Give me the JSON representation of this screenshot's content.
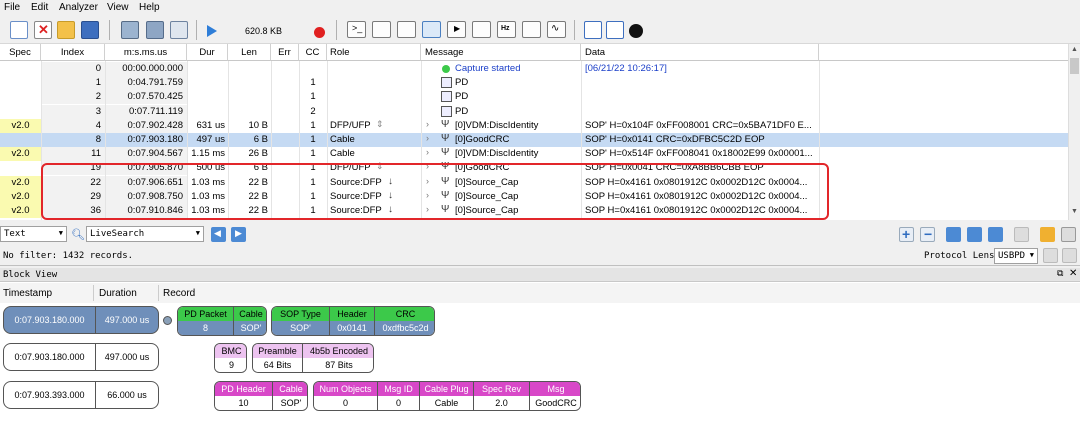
{
  "menu": [
    "File",
    "Edit",
    "Analyzer",
    "View",
    "Help"
  ],
  "toolbar": {
    "size_label": "620.8 KB"
  },
  "columns": [
    "Spec",
    "Index",
    "m:s.ms.us",
    "Dur",
    "Len",
    "Err",
    "CC",
    "Role",
    "Message",
    "Data"
  ],
  "rows": [
    {
      "spec": "",
      "index": "0",
      "time": "00:00.000.000",
      "dur": "",
      "len": "",
      "err": "",
      "cc": "",
      "role": "",
      "message": "Capture started",
      "data": "[06/21/22 10:26:17]"
    },
    {
      "spec": "",
      "index": "1",
      "time": "0:04.791.759",
      "dur": "",
      "len": "",
      "err": "",
      "cc": "1",
      "role": "",
      "message": "PD",
      "data": ""
    },
    {
      "spec": "",
      "index": "2",
      "time": "0:07.570.425",
      "dur": "",
      "len": "",
      "err": "",
      "cc": "1",
      "role": "",
      "message": "PD",
      "data": ""
    },
    {
      "spec": "",
      "index": "3",
      "time": "0:07.711.119",
      "dur": "",
      "len": "",
      "err": "",
      "cc": "2",
      "role": "",
      "message": "PD",
      "data": ""
    },
    {
      "spec": "v2.0",
      "index": "4",
      "time": "0:07.902.428",
      "dur": "631 us",
      "len": "10 B",
      "err": "",
      "cc": "1",
      "role": "DFP/UFP",
      "message": "[0]VDM:DiscIdentity",
      "data": "SOP' H=0x104F 0xFF008001 CRC=0x5BA71DF0 E..."
    },
    {
      "spec": "",
      "index": "8",
      "time": "0:07.903.180",
      "dur": "497 us",
      "len": "6 B",
      "err": "",
      "cc": "1",
      "role": "Cable",
      "message": "[0]GoodCRC",
      "data": "SOP' H=0x0141 CRC=0xDFBC5C2D EOP"
    },
    {
      "spec": "v2.0",
      "index": "11",
      "time": "0:07.904.567",
      "dur": "1.15 ms",
      "len": "26 B",
      "err": "",
      "cc": "1",
      "role": "Cable",
      "message": "[0]VDM:DiscIdentity",
      "data": "SOP' H=0x514F 0xFF008041 0x18002E99 0x00001..."
    },
    {
      "spec": "",
      "index": "19",
      "time": "0:07.905.870",
      "dur": "500 us",
      "len": "6 B",
      "err": "",
      "cc": "1",
      "role": "DFP/UFP",
      "message": "[0]GoodCRC",
      "data": "SOP' H=0x0041 CRC=0xA8BB6CBB EOP"
    },
    {
      "spec": "v2.0",
      "index": "22",
      "time": "0:07.906.651",
      "dur": "1.03 ms",
      "len": "22 B",
      "err": "",
      "cc": "1",
      "role": "Source:DFP",
      "message": "[0]Source_Cap",
      "data": "SOP H=0x4161 0x0801912C 0x0002D12C 0x0004..."
    },
    {
      "spec": "v2.0",
      "index": "29",
      "time": "0:07.908.750",
      "len": "22 B",
      "dur": "1.03 ms",
      "err": "",
      "cc": "1",
      "role": "Source:DFP",
      "message": "[0]Source_Cap",
      "data": "SOP H=0x4161 0x0801912C 0x0002D12C 0x0004..."
    },
    {
      "spec": "v2.0",
      "index": "36",
      "time": "0:07.910.846",
      "dur": "1.03 ms",
      "len": "22 B",
      "err": "",
      "cc": "1",
      "role": "Source:DFP",
      "message": "[0]Source_Cap",
      "data": "SOP H=0x4161 0x0801912C 0x0002D12C 0x0004..."
    }
  ],
  "filter": {
    "type": "Text",
    "search": "LiveSearch"
  },
  "status": {
    "text": "No filter: 1432 records.",
    "lens_label": "Protocol Lens:",
    "lens_value": "USBPD"
  },
  "blockview": {
    "title": "Block View",
    "headers": [
      "Timestamp",
      "Duration",
      "Record"
    ],
    "rows": [
      {
        "timestamp": "0:07.903.180.000",
        "duration": "497.000 us"
      },
      {
        "timestamp": "0:07.903.180.000",
        "duration": "497.000 us"
      },
      {
        "timestamp": "0:07.903.393.000",
        "duration": "66.000 us"
      }
    ],
    "g1": [
      {
        "h": "PD Packet",
        "v": "8"
      },
      {
        "h": "Cable",
        "v": "SOP'"
      }
    ],
    "g2": [
      {
        "h": "SOP Type",
        "v": "SOP'"
      },
      {
        "h": "Header",
        "v": "0x0141"
      },
      {
        "h": "CRC",
        "v": "0xdfbc5c2d"
      }
    ],
    "g3": [
      {
        "h": "BMC",
        "v": "9"
      }
    ],
    "g4": [
      {
        "h": "Preamble",
        "v": "64 Bits"
      },
      {
        "h": "4b5b Encoded",
        "v": "87 Bits"
      }
    ],
    "g5": [
      {
        "h": "PD Header",
        "v": "10"
      },
      {
        "h": "Cable",
        "v": "SOP'"
      }
    ],
    "g6": [
      {
        "h": "Num Objects",
        "v": "0"
      },
      {
        "h": "Msg ID",
        "v": "0"
      },
      {
        "h": "Cable Plug",
        "v": "Cable"
      },
      {
        "h": "Spec Rev",
        "v": "2.0"
      },
      {
        "h": "Msg",
        "v": "GoodCRC"
      }
    ]
  }
}
